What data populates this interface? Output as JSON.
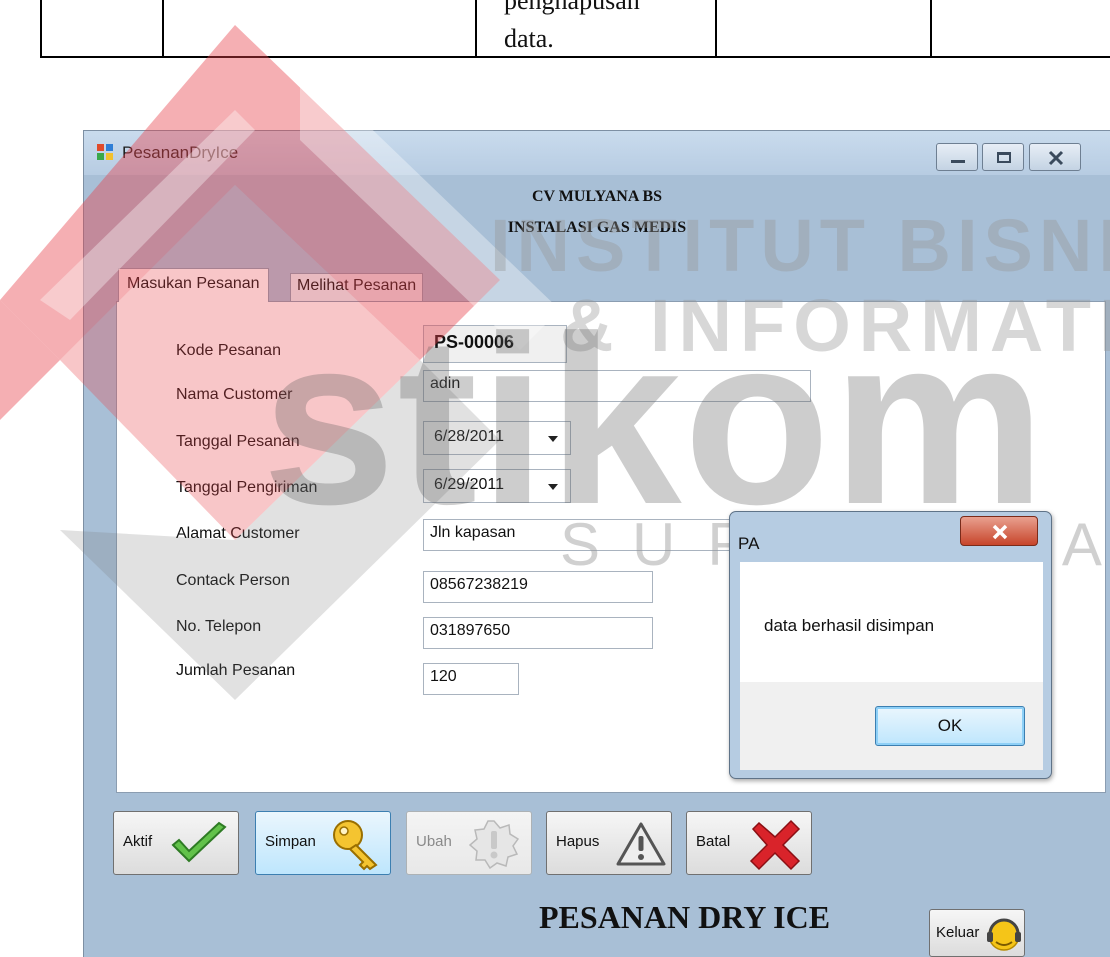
{
  "document": {
    "text_line1": "penghapusan",
    "text_line2": "data."
  },
  "watermark": {
    "line1": "INSTITUT BISNIS",
    "line2": "& INFORMATIKA",
    "brand": "stikom",
    "city": "SURABAYA"
  },
  "window": {
    "title": "PesananDryIce",
    "header_line1": "CV MULYANA BS",
    "header_line2": "INSTALASI GAS MEDIS",
    "footer_title": "PESANAN DRY ICE"
  },
  "tabs": [
    {
      "label": "Masukan Pesanan",
      "active": true
    },
    {
      "label": "Melihat Pesanan",
      "active": false
    }
  ],
  "form": {
    "kode_pesanan": {
      "label": "Kode Pesanan",
      "value": "PS-00006"
    },
    "nama_customer": {
      "label": "Nama Customer",
      "value": "adin"
    },
    "tanggal_pesanan": {
      "label": "Tanggal Pesanan",
      "value": "6/28/2011"
    },
    "tanggal_pengiriman": {
      "label": "Tanggal Pengiriman",
      "value": "6/29/2011"
    },
    "alamat_customer": {
      "label": "Alamat Customer",
      "value": "Jln kapasan"
    },
    "contact_person": {
      "label": "Contack Person",
      "value": "08567238219"
    },
    "no_telepon": {
      "label": "No. Telepon",
      "value": "031897650"
    },
    "jumlah_pesanan": {
      "label": "Jumlah Pesanan",
      "value": "120"
    }
  },
  "buttons": {
    "aktif": "Aktif",
    "simpan": "Simpan",
    "ubah": "Ubah",
    "hapus": "Hapus",
    "batal": "Batal",
    "keluar": "Keluar"
  },
  "dialog": {
    "title": "PA",
    "message": "data berhasil disimpan",
    "ok_label": "OK"
  },
  "colors": {
    "window_bg": "#a8bfd6",
    "watermark_red": "#e8414a",
    "close_red": "#c7452b"
  }
}
